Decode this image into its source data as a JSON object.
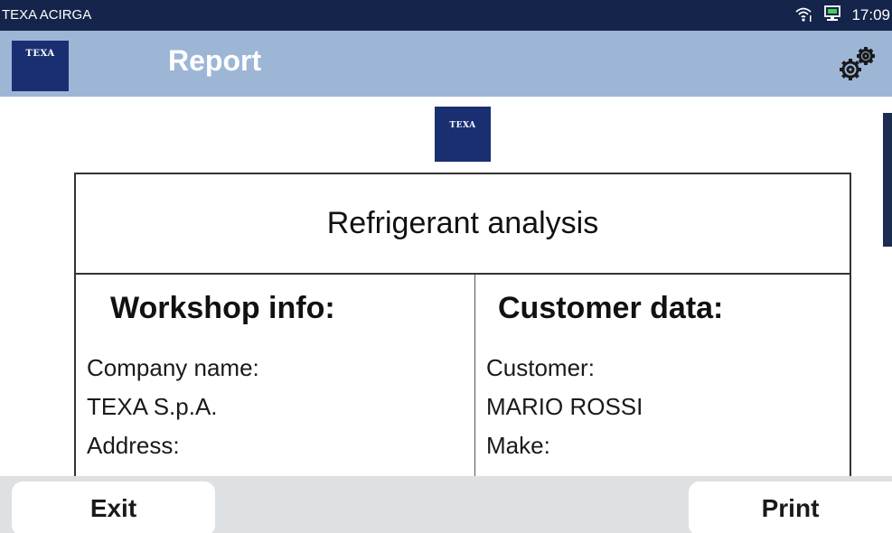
{
  "status_bar": {
    "app_name": "TEXA ACIRGA",
    "time": "17:09",
    "icons": [
      "wifi-icon",
      "network-monitor-icon"
    ]
  },
  "header": {
    "logo_text": "TEXA",
    "title": "Report",
    "settings_icon": "gears-icon"
  },
  "report": {
    "logo_text": "TEXA",
    "title": "Refrigerant analysis",
    "workshop": {
      "heading": "Workshop info:",
      "fields": [
        "Company name:",
        "TEXA S.p.A.",
        "Address:"
      ]
    },
    "customer": {
      "heading": "Customer data:",
      "fields": [
        "Customer:",
        "MARIO ROSSI",
        "Make:"
      ]
    }
  },
  "footer": {
    "exit_label": "Exit",
    "print_label": "Print"
  },
  "colors": {
    "status_bar": "#15244a",
    "header": "#9db6d6",
    "brand": "#1a2f72",
    "footer": "#dee1e4"
  }
}
